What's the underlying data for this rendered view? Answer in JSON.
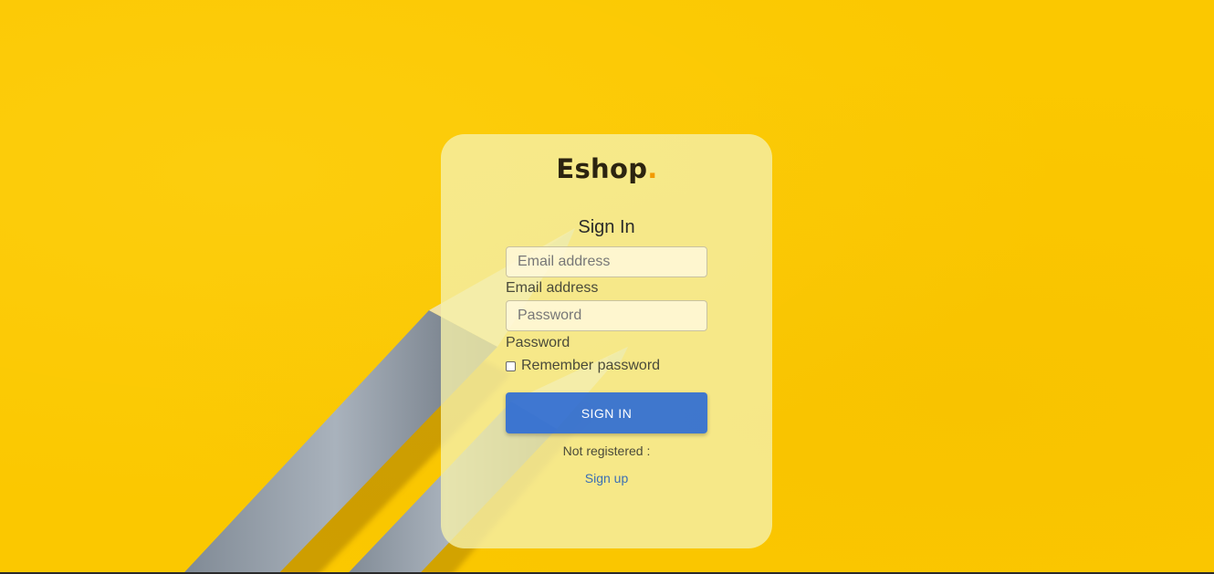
{
  "brand": {
    "name": "Eshop",
    "dot": "."
  },
  "form": {
    "title": "Sign In",
    "email": {
      "placeholder": "Email address",
      "label": "Email address",
      "value": ""
    },
    "password": {
      "placeholder": "Password",
      "label": "Password",
      "value": ""
    },
    "remember": {
      "label": "Remember password",
      "checked": false
    },
    "submit_label": "SIGN IN",
    "not_registered_text": "Not registered :",
    "signup_label": "Sign up"
  },
  "colors": {
    "background": "#fbc800",
    "card": "#f5f0aa",
    "accent_dot": "#f29a00",
    "button": "#2666d6",
    "link": "#3c6fb4"
  }
}
